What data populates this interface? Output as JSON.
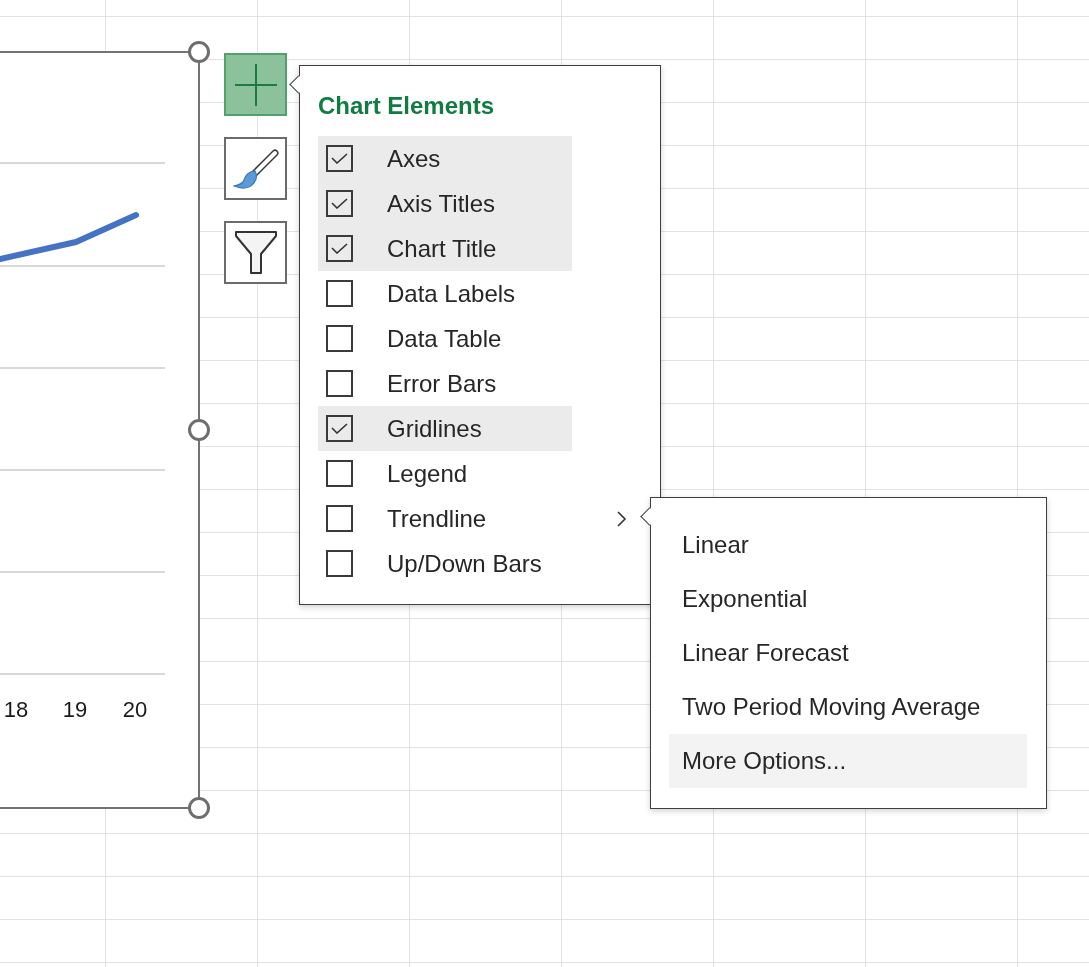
{
  "chart": {
    "selected": true,
    "x_labels": [
      "18",
      "19",
      "20"
    ]
  },
  "chart_buttons": [
    {
      "kind": "elements",
      "selected": true
    },
    {
      "kind": "styles",
      "selected": false
    },
    {
      "kind": "filters",
      "selected": false
    }
  ],
  "chart_elements": {
    "title": "Chart Elements",
    "items": [
      {
        "label": "Axes",
        "checked": true,
        "has_submenu": false
      },
      {
        "label": "Axis Titles",
        "checked": true,
        "has_submenu": false
      },
      {
        "label": "Chart Title",
        "checked": true,
        "has_submenu": false
      },
      {
        "label": "Data Labels",
        "checked": false,
        "has_submenu": false
      },
      {
        "label": "Data Table",
        "checked": false,
        "has_submenu": false
      },
      {
        "label": "Error Bars",
        "checked": false,
        "has_submenu": false
      },
      {
        "label": "Gridlines",
        "checked": true,
        "has_submenu": false
      },
      {
        "label": "Legend",
        "checked": false,
        "has_submenu": false
      },
      {
        "label": "Trendline",
        "checked": false,
        "has_submenu": true
      },
      {
        "label": "Up/Down Bars",
        "checked": false,
        "has_submenu": false
      }
    ]
  },
  "trendline_submenu": {
    "items": [
      {
        "label": "Linear",
        "selected": false
      },
      {
        "label": "Exponential",
        "selected": false
      },
      {
        "label": "Linear Forecast",
        "selected": false
      },
      {
        "label": "Two Period Moving Average",
        "selected": false
      },
      {
        "label": "More Options...",
        "selected": true
      }
    ]
  }
}
